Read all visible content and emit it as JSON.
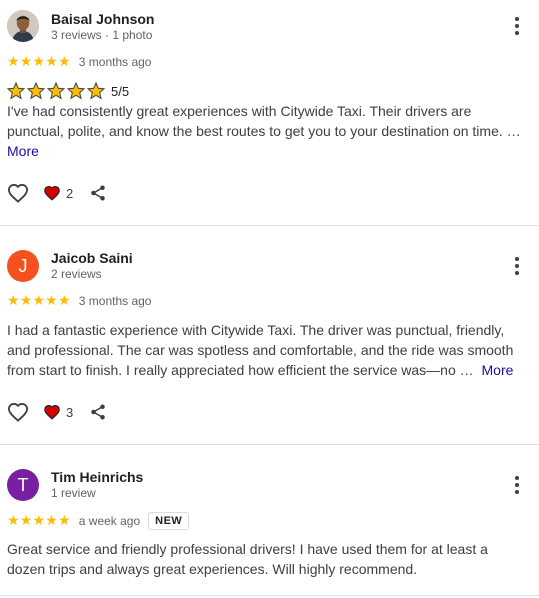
{
  "reviews": [
    {
      "name": "Baisal Johnson",
      "meta": "3 reviews · 1 photo",
      "stars": "★★★★★",
      "time": "3 months ago",
      "score": "5/5",
      "text": "I've had consistently great experiences with Citywide Taxi. Their drivers are punctual, polite, and know the best routes to get you to your destination on time. …",
      "more": "More",
      "likes": "2"
    },
    {
      "name": "Jaicob Saini",
      "initial": "J",
      "avatar_color": "#f4511e",
      "meta": "2 reviews",
      "stars": "★★★★★",
      "time": "3 months ago",
      "text": "I had a fantastic experience with Citywide Taxi. The driver was punctual, friendly, and professional. The car was spotless and comfortable, and the ride was smooth from start to finish. I really appreciated how efficient the service was—no …",
      "more": "More",
      "likes": "3"
    },
    {
      "name": "Tim Heinrichs",
      "initial": "T",
      "avatar_color": "#7b1fa2",
      "meta": "1 review",
      "stars": "★★★★★",
      "time": "a week ago",
      "badge": "NEW",
      "text": "Great service and friendly professional drivers! I have used them for at least a dozen trips and always great experiences. Will highly recommend."
    }
  ],
  "icons": {
    "like": "heart-outline-icon",
    "reaction": "heart-filled-icon",
    "share": "share-icon",
    "menu": "more-vert-icon"
  },
  "colors": {
    "star": "#fbbc04",
    "heart": "#d50000",
    "link": "#1a0dab"
  }
}
